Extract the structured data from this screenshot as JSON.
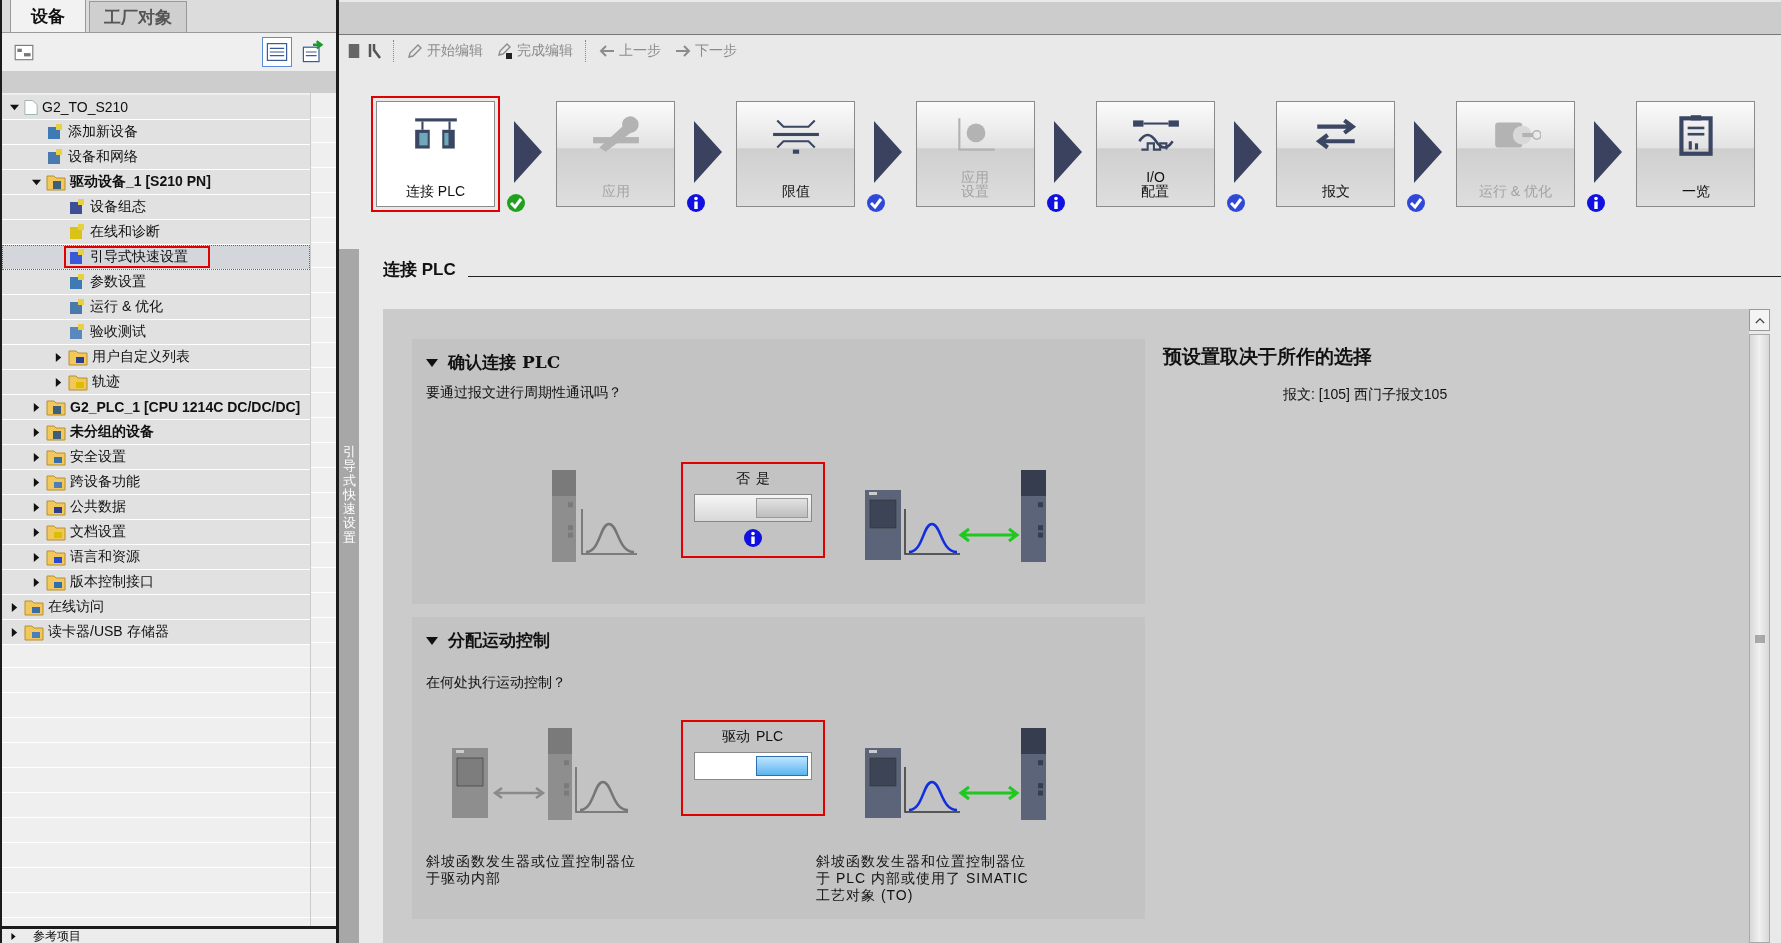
{
  "left_panel": {
    "tabs": [
      {
        "label": "设备",
        "selected": true
      },
      {
        "label": "工厂对象",
        "selected": false
      }
    ],
    "tree": [
      {
        "label": "G2_TO_S210",
        "kind": "project",
        "expanded": true,
        "selected": false,
        "highlighted": false,
        "children": [
          {
            "label": "添加新设备",
            "kind": "item",
            "selected": false,
            "highlighted": false
          },
          {
            "label": "设备和网络",
            "kind": "item",
            "selected": false,
            "highlighted": false
          },
          {
            "label": "驱动设备_1 [S210 PN]",
            "kind": "device",
            "expanded": true,
            "selected": false,
            "highlighted": false,
            "children": [
              {
                "label": "设备组态",
                "kind": "item",
                "selected": false,
                "highlighted": false
              },
              {
                "label": "在线和诊断",
                "kind": "item",
                "selected": false,
                "highlighted": false
              },
              {
                "label": "引导式快速设置",
                "kind": "item",
                "selected": true,
                "highlighted": true
              },
              {
                "label": "参数设置",
                "kind": "item",
                "selected": false,
                "highlighted": false
              },
              {
                "label": "运行 & 优化",
                "kind": "item",
                "selected": false,
                "highlighted": false
              },
              {
                "label": "验收测试",
                "kind": "item",
                "selected": false,
                "highlighted": false
              },
              {
                "label": "用户自定义列表",
                "kind": "folder",
                "expanded": false,
                "selected": false,
                "highlighted": false
              },
              {
                "label": "轨迹",
                "kind": "folder",
                "expanded": false,
                "selected": false,
                "highlighted": false
              }
            ]
          },
          {
            "label": "G2_PLC_1 [CPU 1214C DC/DC/DC]",
            "kind": "device",
            "expanded": false,
            "selected": false,
            "highlighted": false
          },
          {
            "label": "未分组的设备",
            "kind": "device",
            "expanded": false,
            "selected": false,
            "highlighted": false
          },
          {
            "label": "安全设置",
            "kind": "folder",
            "expanded": false,
            "selected": false,
            "highlighted": false
          },
          {
            "label": "跨设备功能",
            "kind": "folder",
            "expanded": false,
            "selected": false,
            "highlighted": false
          },
          {
            "label": "公共数据",
            "kind": "folder",
            "expanded": false,
            "selected": false,
            "highlighted": false
          },
          {
            "label": "文档设置",
            "kind": "folder",
            "expanded": false,
            "selected": false,
            "highlighted": false
          },
          {
            "label": "语言和资源",
            "kind": "folder",
            "expanded": false,
            "selected": false,
            "highlighted": false
          },
          {
            "label": "版本控制接口",
            "kind": "folder",
            "expanded": false,
            "selected": false,
            "highlighted": false
          }
        ]
      },
      {
        "label": "在线访问",
        "kind": "folder",
        "expanded": false,
        "selected": false,
        "highlighted": false
      },
      {
        "label": "读卡器/USB 存储器",
        "kind": "folder",
        "expanded": false,
        "selected": false,
        "highlighted": false
      }
    ],
    "footer": {
      "label": "参考项目",
      "expanded": false
    }
  },
  "toolbar": [
    {
      "label": "开始编辑",
      "disabled": true
    },
    {
      "label": "完成编辑",
      "disabled": true
    },
    {
      "label": "上一步",
      "disabled": true
    },
    {
      "label": "下一步",
      "disabled": true
    }
  ],
  "steps": [
    {
      "label": "连接 PLC",
      "selected": true,
      "disabled": false,
      "highlighted": true,
      "badge": {
        "kind": "check",
        "color": "#1ea11e"
      }
    },
    {
      "label": "应用",
      "selected": false,
      "disabled": true,
      "highlighted": false,
      "badge": {
        "kind": "info",
        "color": "#1010e0"
      }
    },
    {
      "label": "限值",
      "selected": false,
      "disabled": false,
      "highlighted": false,
      "badge": {
        "kind": "check",
        "color": "#2f48d8"
      }
    },
    {
      "label": "应用设置",
      "wrap": true,
      "selected": false,
      "disabled": true,
      "highlighted": false,
      "badge": {
        "kind": "info",
        "color": "#1010e0"
      }
    },
    {
      "label": "I/O 配置",
      "wrap": true,
      "selected": false,
      "disabled": false,
      "highlighted": false,
      "badge": {
        "kind": "check",
        "color": "#2f48d8"
      }
    },
    {
      "label": "报文",
      "selected": false,
      "disabled": false,
      "highlighted": false,
      "badge": {
        "kind": "check",
        "color": "#2f48d8"
      }
    },
    {
      "label": "运行 & 优化",
      "selected": false,
      "disabled": true,
      "highlighted": false,
      "badge": {
        "kind": "info",
        "color": "#1010e0"
      }
    },
    {
      "label": "一览",
      "selected": false,
      "disabled": false,
      "highlighted": false
    }
  ],
  "vertical_tab": {
    "label": "引导式快速设置"
  },
  "page_title": "连接 PLC",
  "sections": [
    {
      "title": "确认连接 PLC",
      "expanded": true,
      "question": "要通过报文进行周期性通讯吗？",
      "switch": {
        "options": [
          {
            "label": "否",
            "selected": false
          },
          {
            "label": "是",
            "selected": true
          }
        ],
        "disabled": true,
        "highlighted": true,
        "info": true
      }
    },
    {
      "title": "分配运动控制",
      "expanded": true,
      "question": "在何处执行运动控制？",
      "switch": {
        "options": [
          {
            "label": "驱动",
            "selected": false
          },
          {
            "label": "PLC",
            "selected": true
          }
        ],
        "disabled": false,
        "highlighted": true,
        "info": false
      },
      "captions": [
        "斜坡函数发生器或位置控制器位于驱动内部",
        "斜坡函数发生器和位置控制器位于 PLC 内部或使用了 SIMATIC 工艺对象 (TO)"
      ]
    }
  ],
  "summary": {
    "title": "预设置取决于所作的选择",
    "line": "报文: [105] 西门子报文105"
  }
}
